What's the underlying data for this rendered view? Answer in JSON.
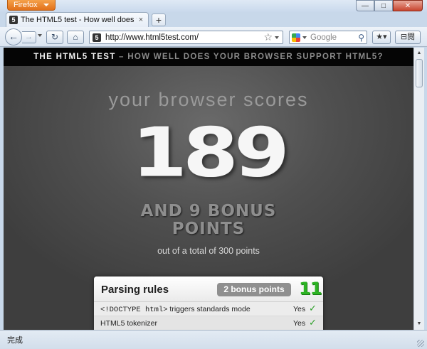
{
  "browser": {
    "menu_label": "Firefox",
    "window_buttons": {
      "minimize": "—",
      "maximize": "□",
      "close": "✕"
    }
  },
  "tabs": [
    {
      "title": "The HTML5 test - How well does your...",
      "favicon": "5",
      "close": "×"
    }
  ],
  "newtab": "+",
  "nav": {
    "back": "←",
    "forward": "→",
    "reload": "↻",
    "home": "⌂",
    "url": "http://www.html5test.com/",
    "bookmark_star": "☆",
    "search_engine": "Google",
    "search_placeholder": "Google",
    "search_go": "⚲",
    "bookmarks_btn": "★▾",
    "menu_btn": "⊟閱"
  },
  "site": {
    "header_title": "THE HTML5 TEST",
    "header_sep": " – ",
    "header_subtitle": "HOW WELL DOES YOUR BROWSER SUPPORT HTML5?",
    "tagline": "your browser scores",
    "score": "189",
    "bonus_line1": "AND 9 BONUS",
    "bonus_line2": "POINTS",
    "total": "out of a total of 300 points"
  },
  "sections": [
    {
      "title": "Parsing rules",
      "bonus": "2 bonus points",
      "score": "11",
      "rows": [
        {
          "code": "<!DOCTYPE html>",
          "label": " triggers standards mode",
          "value": "Yes",
          "check": "✓"
        },
        {
          "code": "",
          "label": "HTML5 tokenizer",
          "value": "Yes",
          "check": "✓"
        }
      ]
    }
  ],
  "statusbar": {
    "text": "完成"
  },
  "colors": {
    "accent_green": "#2db324",
    "firefox_orange": "#e2711a",
    "header_bg": "#050505",
    "page_bg": "#505050"
  }
}
